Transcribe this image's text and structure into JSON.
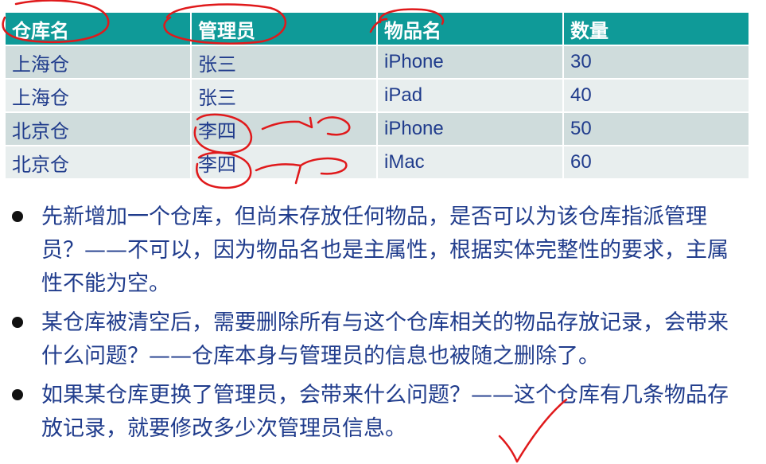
{
  "table": {
    "headers": [
      "仓库名",
      "管理员",
      "物品名",
      "数量"
    ],
    "rows": [
      [
        "上海仓",
        "张三",
        "iPhone",
        "30"
      ],
      [
        "上海仓",
        "张三",
        "iPad",
        "40"
      ],
      [
        "北京仓",
        "李四",
        "iPhone",
        "50"
      ],
      [
        "北京仓",
        "李四",
        "iMac",
        "60"
      ]
    ]
  },
  "bullets": [
    "先新增加一个仓库，但尚未存放任何物品，是否可以为该仓库指派管理员？——不可以，因为物品名也是主属性，根据实体完整性的要求，主属性不能为空。",
    "某仓库被清空后，需要删除所有与这个仓库相关的物品存放记录，会带来什么问题？——仓库本身与管理员的信息也被随之删除了。",
    "如果某仓库更换了管理员，会带来什么问题？——这个仓库有几条物品存放记录，就要修改多少次管理员信息。"
  ],
  "colors": {
    "header_bg": "#0f9a98",
    "row_odd": "#cfdcdc",
    "row_even": "#e8eeee",
    "text": "#203c8c",
    "annotation_ink": "#e0191b"
  }
}
